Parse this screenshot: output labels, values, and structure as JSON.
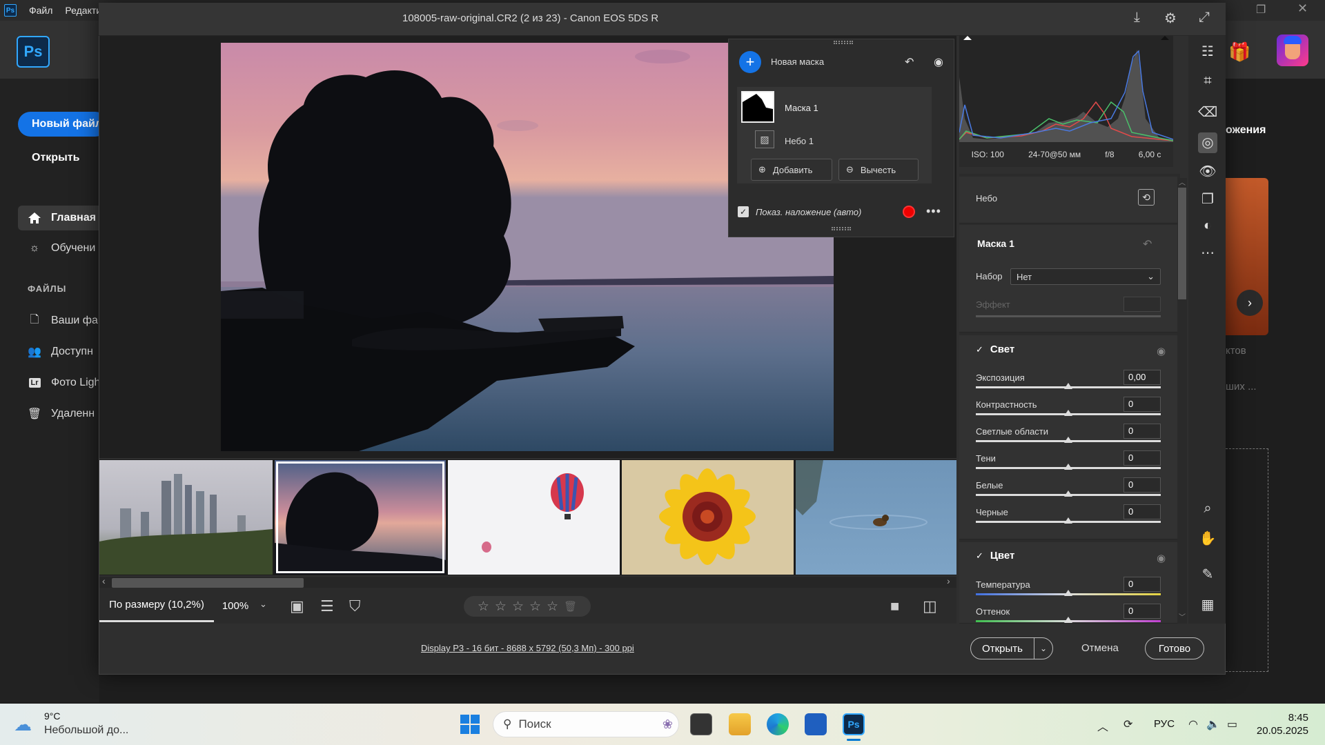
{
  "ps_home": {
    "menu": [
      "Файл",
      "Редакти"
    ],
    "app_badge": "Ps",
    "new_file": "Новый файл",
    "open": "Открыть",
    "nav": [
      {
        "label": "Главная",
        "icon": "home-icon",
        "active": true
      },
      {
        "label": "Обучени",
        "icon": "lightbulb-icon",
        "active": false
      }
    ],
    "files_title": "ФАЙЛЫ",
    "files": [
      {
        "label": "Ваши фа",
        "icon": "file-icon"
      },
      {
        "label": "Доступн",
        "icon": "shared-users-icon"
      },
      {
        "label": "Фото Ligh",
        "icon": "lightroom-icon"
      },
      {
        "label": "Удаленн",
        "icon": "trash-icon"
      }
    ],
    "lr_badge": "Lr",
    "right_text": "ожения",
    "right_dim_1": "ктов",
    "right_dim_2": "ших ..."
  },
  "dialog": {
    "title": "108005-raw-original.CR2 (2 из 23)  -  Canon EOS 5DS R",
    "mask_panel": {
      "new_mask": "Новая маска",
      "mask_name": "Маска 1",
      "component": "Небо 1",
      "add": "Добавить",
      "subtract": "Вычесть",
      "overlay_label": "Показ. наложение (авто)",
      "overlay_color": "#e00000"
    },
    "filmstrip": {
      "selected_index": 1,
      "thumbs": [
        "city-skyline",
        "tree-lake-sunset",
        "hot-air-balloons",
        "yellow-flower",
        "duckling-water"
      ]
    },
    "bottom": {
      "fit": "По размеру (10,2%)",
      "zoom": "100%",
      "rating_stars": 0
    },
    "status_link": "Display P3 - 16 бит - 8688 x 5792 (50,3 Мп) - 300 ppi",
    "open_btn": "Открыть",
    "cancel_btn": "Отмена",
    "done_btn": "Готово",
    "histogram_meta": {
      "iso": "ISO: 100",
      "lens": "24-70@50 мм",
      "aperture": "f/8",
      "shutter": "6,00 с"
    },
    "panel": {
      "mask_type": "Небо",
      "mask_title": "Маска 1",
      "preset_label": "Набор",
      "preset_value": "Нет",
      "effect_label": "Эффект",
      "light_title": "Свет",
      "light_sliders": [
        {
          "label": "Экспозиция",
          "value": "0,00",
          "position": 0.5
        },
        {
          "label": "Контрастность",
          "value": "0",
          "position": 0.5
        },
        {
          "label": "Светлые области",
          "value": "0",
          "position": 0.5
        },
        {
          "label": "Тени",
          "value": "0",
          "position": 0.5
        },
        {
          "label": "Белые",
          "value": "0",
          "position": 0.5
        },
        {
          "label": "Черные",
          "value": "0",
          "position": 0.5
        }
      ],
      "color_title": "Цвет",
      "color_sliders": [
        {
          "label": "Температура",
          "value": "0",
          "position": 0.5
        },
        {
          "label": "Оттенок",
          "value": "0",
          "position": 0.5
        }
      ]
    }
  },
  "taskbar": {
    "temp": "9°C",
    "weather": "Небольшой до...",
    "search_placeholder": "Поиск",
    "lang": "РУС",
    "time": "8:45",
    "date": "20.05.2025"
  }
}
